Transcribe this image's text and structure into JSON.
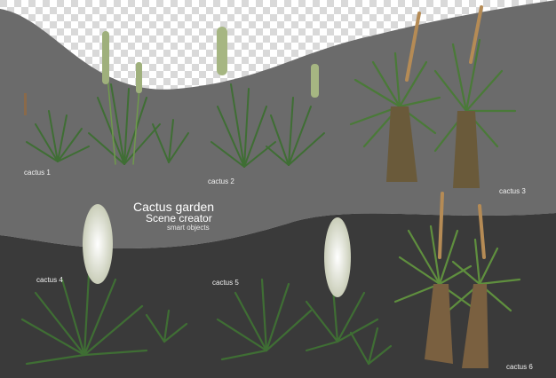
{
  "header": {
    "title": "Cactus garden",
    "subtitle": "Scene creator",
    "tagline": "smart objects"
  },
  "labels": {
    "cactus1": "cactus 1",
    "cactus2": "cactus 2",
    "cactus3": "cactus 3",
    "cactus4": "cactus 4",
    "cactus5": "cactus 5",
    "cactus6": "cactus 6"
  },
  "colors": {
    "checker_light": "#ffffff",
    "checker_dark": "#d9d9d9",
    "mid_gray": "#6b6b6b",
    "dark_gray": "#3a3a3a",
    "leaf_dark": "#2f5a2a",
    "leaf_light": "#7fa85a",
    "flower": "#e8eadb"
  },
  "icons": {
    "plant": "yucca-plant"
  }
}
